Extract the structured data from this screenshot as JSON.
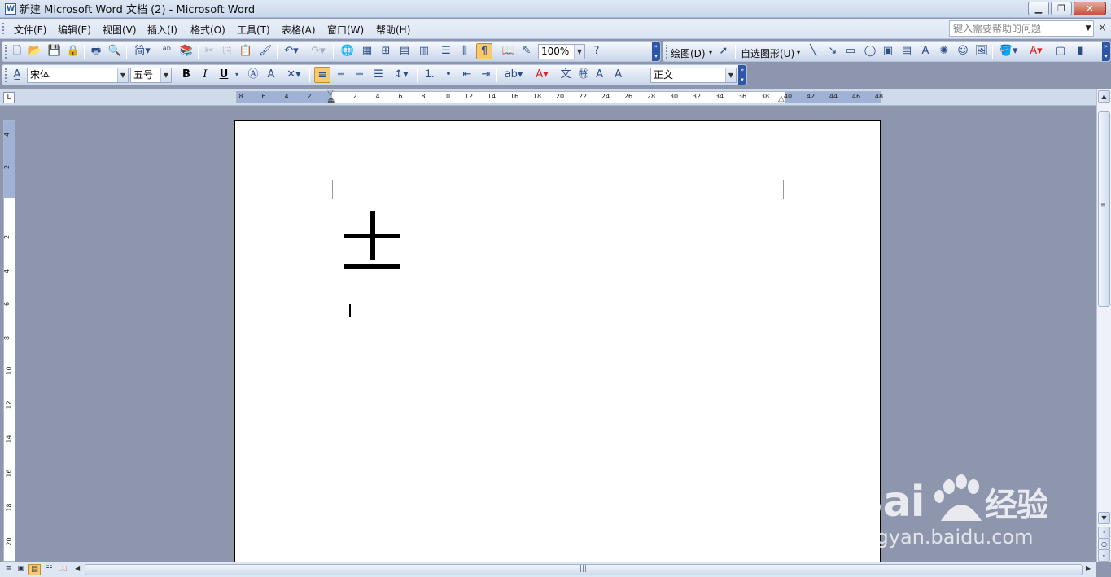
{
  "window": {
    "title": "新建 Microsoft Word 文档 (2) - Microsoft Word",
    "minimize_label": "▁",
    "maximize_label": "❐",
    "close_label": "✕"
  },
  "menu": {
    "items": [
      "文件(F)",
      "编辑(E)",
      "视图(V)",
      "插入(I)",
      "格式(O)",
      "工具(T)",
      "表格(A)",
      "窗口(W)",
      "帮助(H)"
    ],
    "help_placeholder": "键入需要帮助的问题",
    "close_doc": "×"
  },
  "standard_toolbar": {
    "zoom": "100%",
    "draw_label": "绘图(D)",
    "autoshape_label": "自选图形(U)",
    "simplified_label": "简"
  },
  "format_toolbar": {
    "font": "宋体",
    "size": "五号",
    "style": "正文",
    "bold": "B",
    "italic": "I",
    "underline": "U"
  },
  "ruler": {
    "h_numbers": [
      "8",
      "6",
      "4",
      "2",
      "2",
      "4",
      "6",
      "8",
      "10",
      "12",
      "14",
      "16",
      "18",
      "20",
      "22",
      "24",
      "26",
      "28",
      "30",
      "32",
      "34",
      "36",
      "38",
      "40",
      "42",
      "44",
      "46",
      "48"
    ],
    "v_numbers": [
      "4",
      "2",
      "2",
      "4",
      "6",
      "8",
      "10",
      "12",
      "14",
      "16",
      "18",
      "20"
    ]
  },
  "document": {
    "symbol": "±",
    "symbol_name": "plus-minus-sign"
  },
  "watermark": {
    "logo": "Bai du 经验",
    "url": "jingyan.baidu.com"
  },
  "colors": {
    "highlight": "#f9c970",
    "page_bg": "#ffffff",
    "workspace_bg": "#8d96ad",
    "font_color_bar": "#e02020"
  }
}
